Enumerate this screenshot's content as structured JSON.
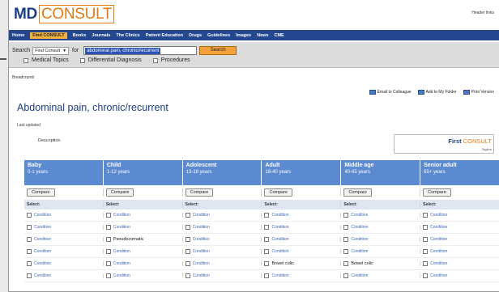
{
  "header": {
    "logo_md": "MD",
    "logo_consult": "CONSULT",
    "top_links": "Header links"
  },
  "nav": {
    "items": [
      {
        "label": "Home",
        "active": false
      },
      {
        "label": "Find CONSULT",
        "active": true
      },
      {
        "label": "Books",
        "active": false
      },
      {
        "label": "Journals",
        "active": false
      },
      {
        "label": "The Clinics",
        "active": false
      },
      {
        "label": "Patient Education",
        "active": false
      },
      {
        "label": "Drugs",
        "active": false
      },
      {
        "label": "Guidelines",
        "active": false
      },
      {
        "label": "Images",
        "active": false
      },
      {
        "label": "News",
        "active": false
      },
      {
        "label": "CME",
        "active": false
      }
    ]
  },
  "search": {
    "label": "Search",
    "scope_value": "Find Consult",
    "for_label": "for",
    "query_value": "abdominal pain, chronic/recurrent",
    "button_label": "Search",
    "filters": [
      {
        "label": "Medical Topics"
      },
      {
        "label": "Differential Diagnosis"
      },
      {
        "label": "Procedures"
      }
    ]
  },
  "breadcrumb": "Breadcrumb",
  "tools": [
    {
      "label": "Email to Colleague"
    },
    {
      "label": "Add to My Folder"
    },
    {
      "label": "Print Version"
    }
  ],
  "page": {
    "title": "Abdominal pain, chronic/recurrent",
    "updated": "Last updated",
    "description": "Description"
  },
  "promo": {
    "label_a": "First",
    "label_b": "CONSULT",
    "tagline": "Tagline"
  },
  "compare_label": "Compare",
  "columns": [
    {
      "group": "Baby",
      "range": "0-1 years",
      "select": "Select:"
    },
    {
      "group": "Child",
      "range": "1-12 years",
      "select": "Select:"
    },
    {
      "group": "Adolescent",
      "range": "13-18 years",
      "select": "Select:"
    },
    {
      "group": "Adult",
      "range": "18-40 years",
      "select": "Select:"
    },
    {
      "group": "Middle age",
      "range": "40-65 years",
      "select": "Select:"
    },
    {
      "group": "Senior adult",
      "range": "65+ years",
      "select": "Select:"
    }
  ],
  "conditions": [
    [
      "Condition",
      "Condition",
      "Condition",
      "Condition",
      "Condition",
      "Condition"
    ],
    [
      "Condition",
      "Condition",
      "Condition",
      "Condition",
      "Condition",
      "Condition"
    ],
    [
      "Condition",
      "Pseudocomatic",
      "Condition",
      "Condition",
      "Condition",
      "Condition"
    ],
    [
      "Condition",
      "Condition",
      "Condition",
      "Condition",
      "Condition",
      "Condition"
    ],
    [
      "Condition",
      "Condition",
      "Condition",
      "Bowel colic",
      "Bowel colic",
      "Condition"
    ],
    [
      "Condition",
      "Condition",
      "Condition",
      "Condition",
      "Condition",
      "Condition"
    ]
  ]
}
